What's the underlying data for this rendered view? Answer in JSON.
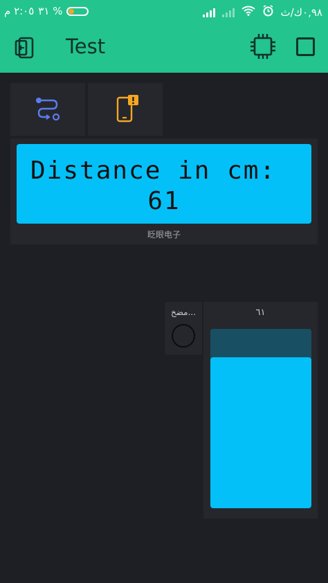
{
  "status_bar": {
    "time": "٢:٠٥ م",
    "battery_text": "٣١ %",
    "battery_level": 0.31,
    "network_speed": "٠,٩٨ك/ث"
  },
  "app_bar": {
    "title": "Test"
  },
  "lcd": {
    "line1": "Distance in cm:",
    "line2": "61",
    "label": "眨眼电子"
  },
  "button": {
    "label": "مضخ..."
  },
  "level": {
    "label": "٦١",
    "value_fraction": 0.84
  },
  "colors": {
    "accent": "#23c48e",
    "lcd_blue": "#04c0f8",
    "warning_orange": "#f5a623"
  }
}
